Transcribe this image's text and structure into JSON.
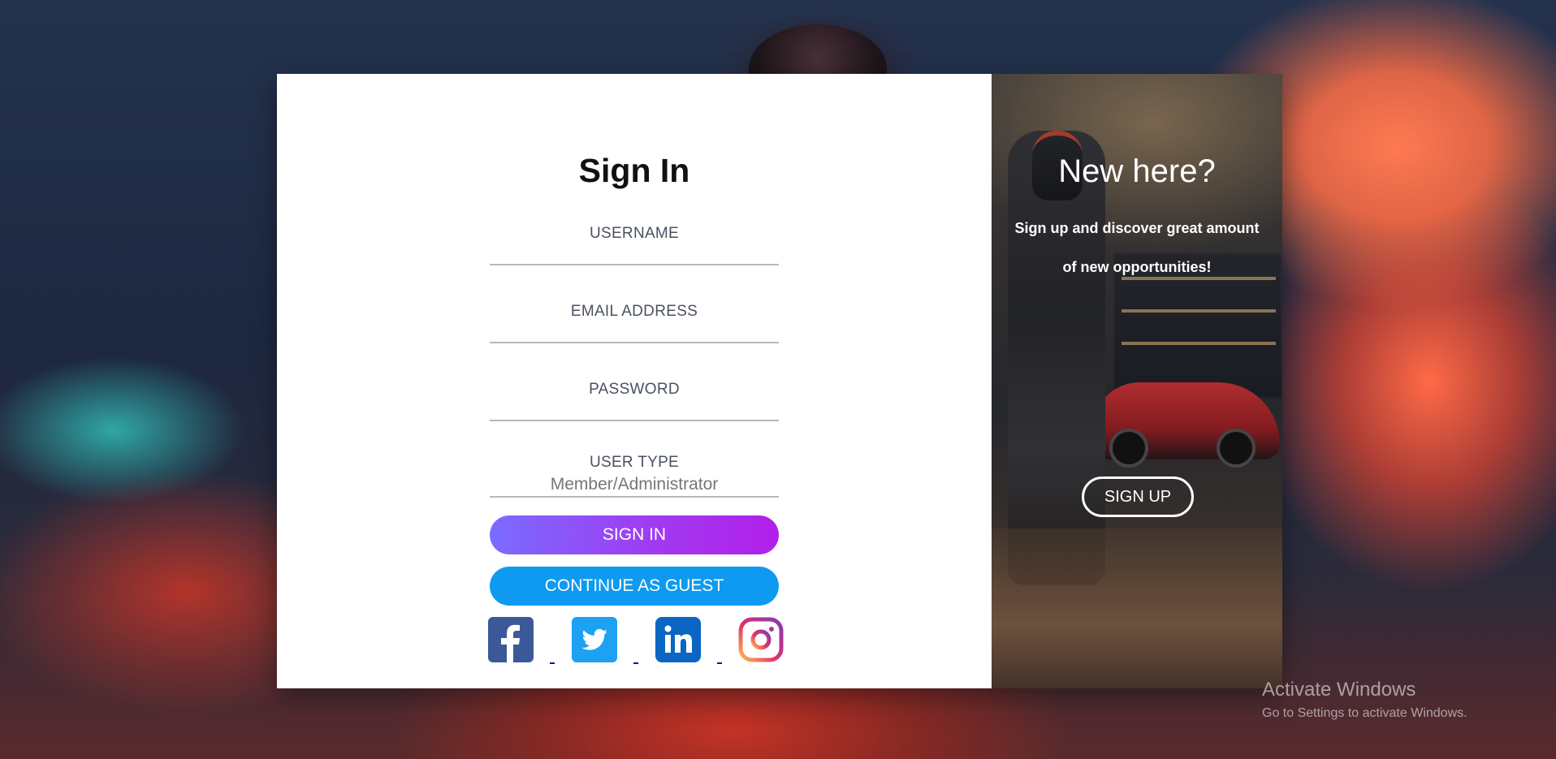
{
  "signin": {
    "title": "Sign In",
    "username_label": "USERNAME",
    "email_label": "EMAIL ADDRESS",
    "password_label": "PASSWORD",
    "user_type_label": "USER TYPE",
    "user_type_placeholder": "Member/Administrator",
    "signin_button": "SIGN IN",
    "guest_button": "CONTINUE AS GUEST"
  },
  "social": {
    "icons": [
      "facebook-icon",
      "twitter-icon",
      "linkedin-icon",
      "instagram-icon"
    ],
    "colors": {
      "facebook": "#3b5998",
      "twitter": "#1da1f2",
      "linkedin": "#0a66c2",
      "instagram": "#c13584"
    }
  },
  "signup_panel": {
    "title": "New here?",
    "subtitle": "Sign up and discover great amount of new opportunities!",
    "button": "SIGN UP"
  },
  "watermark": {
    "line1": "Activate Windows",
    "line2": "Go to Settings to activate Windows."
  },
  "colors": {
    "signin_gradient_start": "#7b6cff",
    "signin_gradient_end": "#b21fea",
    "guest_button": "#0e9af0"
  }
}
